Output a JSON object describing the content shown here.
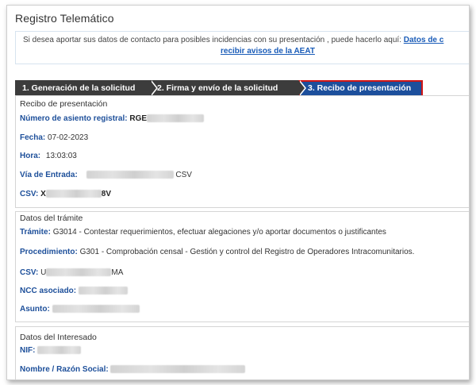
{
  "page": {
    "title": "Registro Telemático"
  },
  "notice": {
    "text": "Si desea aportar sus datos de contacto para posibles incidencias con su presentación , puede hacerlo aquí:",
    "link_part1": "Datos de c",
    "link_part2": "recibir avisos de la AEAT"
  },
  "steps": [
    {
      "label": "1. Generación de la solicitud",
      "active": false
    },
    {
      "label": "2. Firma y envío de la solicitud",
      "active": false
    },
    {
      "label": "3. Recibo de presentación",
      "active": true
    }
  ],
  "receipt": {
    "title": "Recibo de presentación",
    "numero_label": "Número de asiento registral:",
    "numero_value": "RGE",
    "fecha_label": "Fecha:",
    "fecha_value": "07-02-2023",
    "hora_label": "Hora:",
    "hora_value": "13:03:03",
    "via_label": "Vía de Entrada:",
    "via_value": "CSV",
    "csv_label": "CSV:",
    "csv_prefix": "X",
    "csv_suffix": "8V"
  },
  "tramite": {
    "title": "Datos del trámite",
    "tramite_label": "Trámite:",
    "tramite_value": "G3014 - Contestar requerimientos, efectuar alegaciones y/o aportar documentos o justificantes",
    "procedimiento_label": "Procedimiento:",
    "procedimiento_value": "G301 - Comprobación censal - Gestión y control del Registro de Operadores Intracomunitarios.",
    "csv_label": "CSV:",
    "csv_prefix": "U",
    "csv_suffix": "MA",
    "ncc_label": "NCC asociado:",
    "asunto_label": "Asunto:"
  },
  "interesado": {
    "title": "Datos del Interesado",
    "nif_label": "NIF:",
    "nombre_label": "Nombre / Razón Social:"
  },
  "colors": {
    "label_blue": "#1d4f9a",
    "link_blue": "#1a5cb8",
    "active_step": "#1c4f9c",
    "inactive_step": "#3c3c3c",
    "highlight": "#d01515"
  }
}
